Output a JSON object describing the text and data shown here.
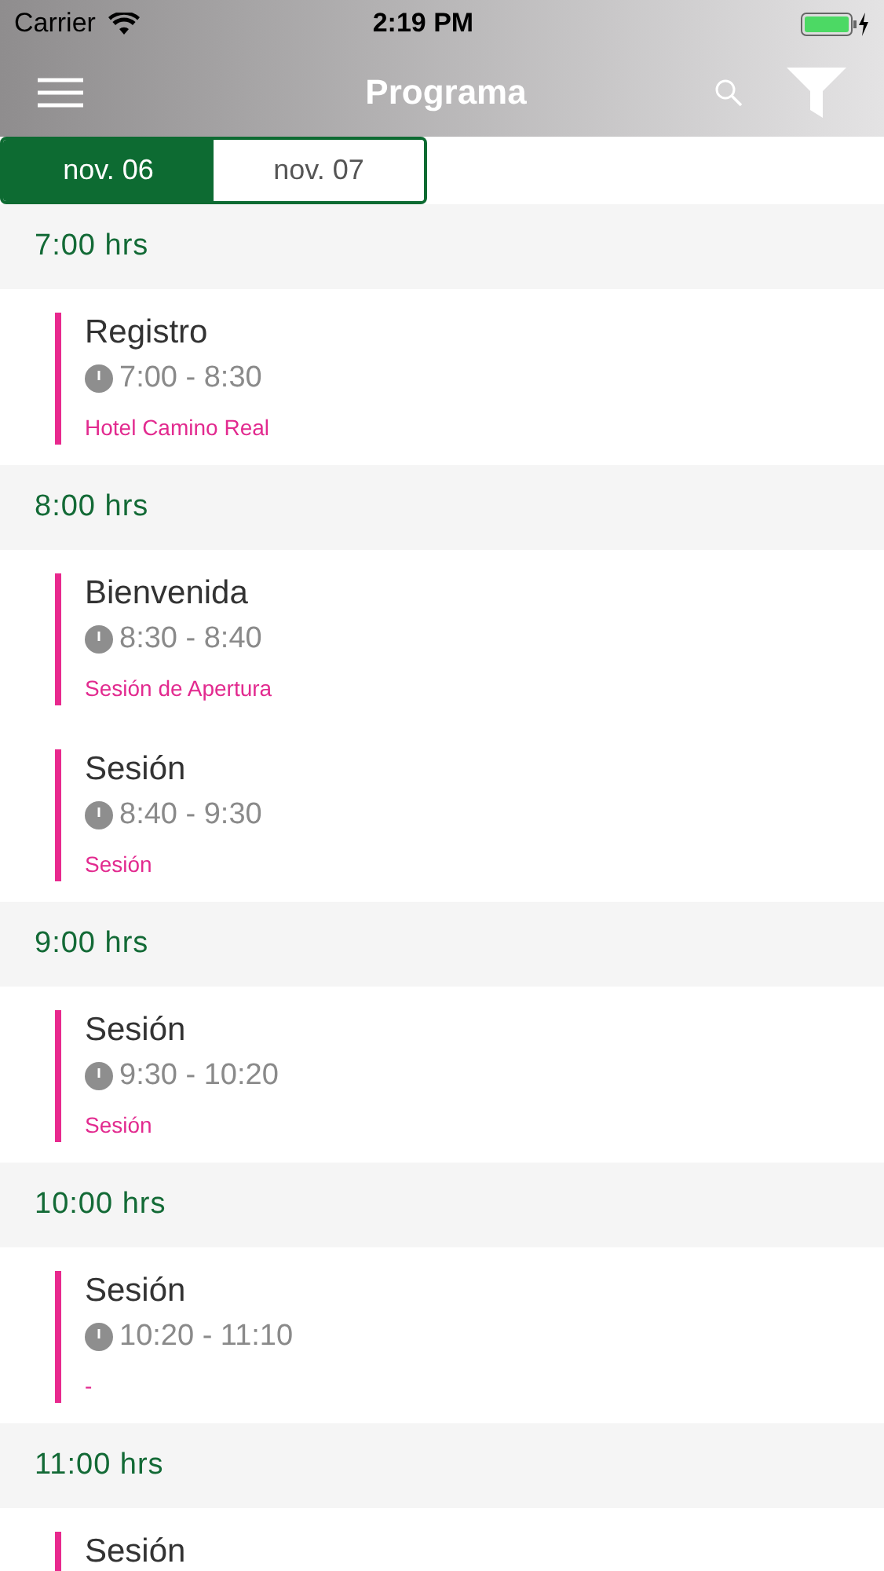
{
  "status_bar": {
    "carrier": "Carrier",
    "time": "2:19 PM"
  },
  "nav_bar": {
    "title": "Programa"
  },
  "date_tabs": [
    {
      "label": "nov. 06",
      "selected": true
    },
    {
      "label": "nov. 07",
      "selected": false
    }
  ],
  "sections": [
    {
      "heading": "7:00 hrs",
      "events": [
        {
          "title": "Registro",
          "time": "7:00 - 8:30",
          "location": "Hotel Camino Real"
        }
      ]
    },
    {
      "heading": "8:00 hrs",
      "events": [
        {
          "title": "Bienvenida",
          "time": "8:30 - 8:40",
          "location": "Sesión de Apertura"
        },
        {
          "title": "Sesión",
          "time": "8:40 - 9:30",
          "location": "Sesión"
        }
      ]
    },
    {
      "heading": "9:00 hrs",
      "events": [
        {
          "title": "Sesión",
          "time": "9:30 - 10:20",
          "location": "Sesión"
        }
      ]
    },
    {
      "heading": "10:00 hrs",
      "events": [
        {
          "title": "Sesión",
          "time": "10:20 - 11:10",
          "location": "-"
        }
      ]
    },
    {
      "heading": "11:00 hrs",
      "events": [
        {
          "title": "Sesión"
        }
      ]
    }
  ]
}
